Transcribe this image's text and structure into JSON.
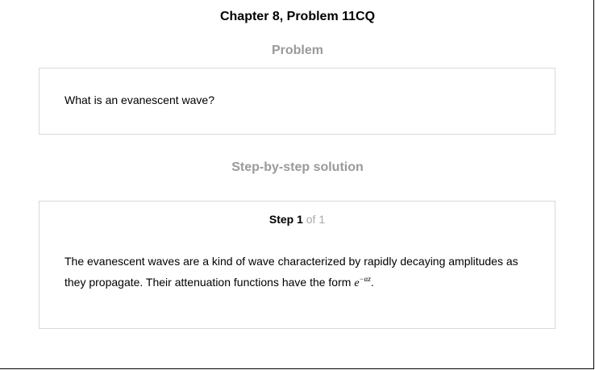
{
  "header": {
    "title": "Chapter 8, Problem 11CQ"
  },
  "problem": {
    "heading": "Problem",
    "text": "What is an evanescent wave?"
  },
  "solution": {
    "heading": "Step-by-step solution",
    "step": {
      "label": "Step 1",
      "of": "of 1",
      "text_line1": "The evanescent waves are a kind of wave characterized by rapidly decaying amplitudes as",
      "text_line2": "they propagate. Their attenuation functions have the form",
      "math_base": "e",
      "math_exponent": "−αz",
      "text_end": "."
    }
  },
  "colors": {
    "heading_gray": "#9a9a9a",
    "border": "#d9d9d9"
  }
}
